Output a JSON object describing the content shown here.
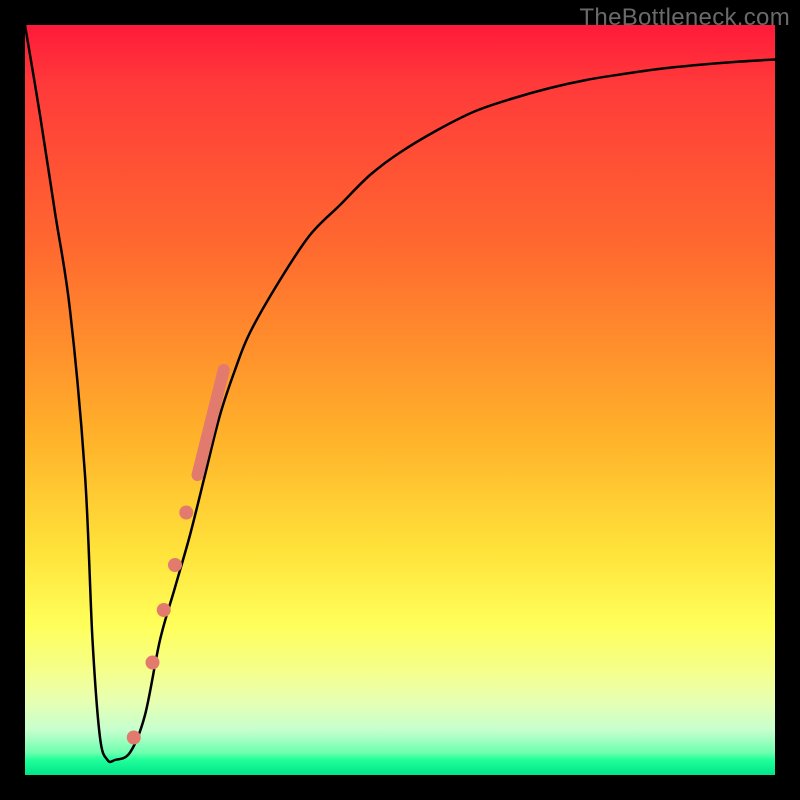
{
  "watermark": "TheBottleneck.com",
  "chart_data": {
    "type": "line",
    "title": "",
    "xlabel": "",
    "ylabel": "",
    "xlim": [
      0,
      100
    ],
    "ylim": [
      0,
      100
    ],
    "background": {
      "type": "vertical-gradient",
      "stops": [
        {
          "pos": 0.0,
          "color": "#ff1a3a"
        },
        {
          "pos": 0.3,
          "color": "#ff6a2f"
        },
        {
          "pos": 0.55,
          "color": "#ffb22a"
        },
        {
          "pos": 0.8,
          "color": "#ffff5a"
        },
        {
          "pos": 0.94,
          "color": "#c6ffcf"
        },
        {
          "pos": 1.0,
          "color": "#00e58a"
        }
      ]
    },
    "series": [
      {
        "name": "bottleneck-curve",
        "color": "#000000",
        "stroke_width": 2.5,
        "x": [
          0,
          2,
          4,
          6,
          8,
          9,
          10,
          11,
          12,
          14,
          16,
          18,
          20,
          22,
          24,
          26,
          28,
          30,
          34,
          38,
          42,
          46,
          50,
          55,
          60,
          65,
          70,
          75,
          80,
          85,
          90,
          95,
          100
        ],
        "y": [
          100,
          88,
          75,
          62,
          40,
          18,
          5,
          2,
          2,
          3,
          8,
          18,
          25,
          32,
          40,
          48,
          54,
          59,
          66,
          72,
          76,
          80,
          83,
          86,
          88.5,
          90.2,
          91.6,
          92.7,
          93.5,
          94.2,
          94.7,
          95.1,
          95.4
        ]
      },
      {
        "name": "highlight-segment",
        "type": "line",
        "color": "#e37a6e",
        "stroke_width": 12,
        "x": [
          23,
          26.5
        ],
        "y": [
          40,
          54
        ]
      },
      {
        "name": "highlight-dots",
        "type": "scatter",
        "color": "#e37a6e",
        "radius": 7,
        "x": [
          14.5,
          17.0,
          18.5,
          20.0,
          21.5
        ],
        "y": [
          5,
          15,
          22,
          28,
          35
        ]
      }
    ]
  }
}
